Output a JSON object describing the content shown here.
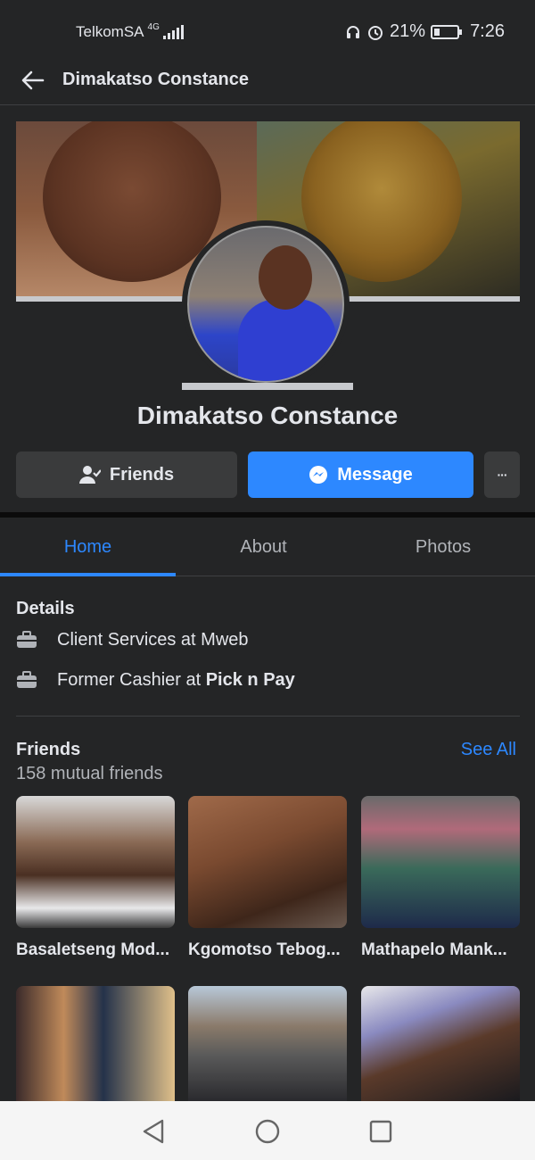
{
  "status_bar": {
    "carrier": "TelkomSA",
    "network": "4G",
    "battery": "21%",
    "time": "7:26",
    "icons": [
      "headset-icon",
      "alarm-icon",
      "battery-icon",
      "signal-icon"
    ]
  },
  "header": {
    "title": "Dimakatso Constance"
  },
  "profile": {
    "name": "Dimakatso Constance"
  },
  "actions": {
    "friends_label": "Friends",
    "message_label": "Message",
    "more_label": "···"
  },
  "tabs": [
    {
      "label": "Home",
      "active": true
    },
    {
      "label": "About",
      "active": false
    },
    {
      "label": "Photos",
      "active": false
    }
  ],
  "details": {
    "title": "Details",
    "work": [
      {
        "prefix": "Client Services at Mweb",
        "bold": ""
      },
      {
        "prefix": "Former Cashier at ",
        "bold": "Pick n Pay"
      }
    ]
  },
  "friends": {
    "title": "Friends",
    "see_all": "See All",
    "mutual": "158 mutual friends",
    "items": [
      {
        "name": "Basaletseng Mod..."
      },
      {
        "name": "Kgomotso Tebog..."
      },
      {
        "name": "Mathapelo Mank..."
      },
      {
        "name": ""
      },
      {
        "name": ""
      },
      {
        "name": ""
      }
    ]
  },
  "colors": {
    "background": "#242526",
    "accent": "#2d88ff",
    "button": "#3a3b3c",
    "text": "#e4e6eb",
    "muted": "#b0b3b8"
  }
}
